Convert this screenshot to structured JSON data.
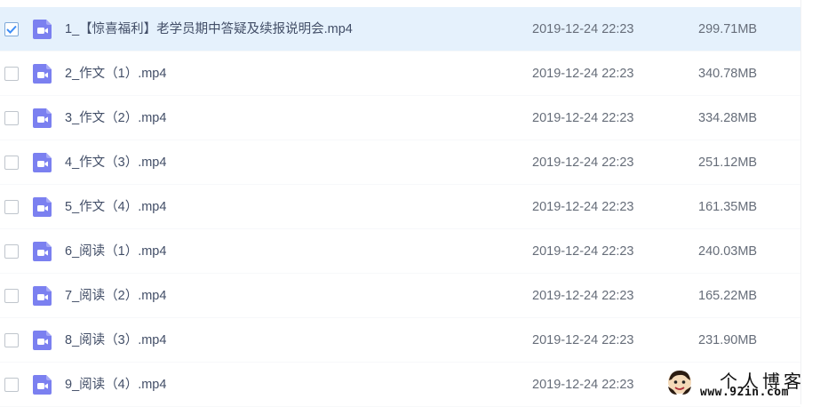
{
  "files": [
    {
      "name": "1_【惊喜福利】老学员期中答疑及续报说明会.mp4",
      "date": "2019-12-24 22:23",
      "size": "299.71MB",
      "checked": true,
      "icon": "video-file-icon"
    },
    {
      "name": "2_作文（1）.mp4",
      "date": "2019-12-24 22:23",
      "size": "340.78MB",
      "checked": false,
      "icon": "video-file-icon"
    },
    {
      "name": "3_作文（2）.mp4",
      "date": "2019-12-24 22:23",
      "size": "334.28MB",
      "checked": false,
      "icon": "video-file-icon"
    },
    {
      "name": "4_作文（3）.mp4",
      "date": "2019-12-24 22:23",
      "size": "251.12MB",
      "checked": false,
      "icon": "video-file-icon"
    },
    {
      "name": "5_作文（4）.mp4",
      "date": "2019-12-24 22:23",
      "size": "161.35MB",
      "checked": false,
      "icon": "video-file-icon"
    },
    {
      "name": "6_阅读（1）.mp4",
      "date": "2019-12-24 22:23",
      "size": "240.03MB",
      "checked": false,
      "icon": "video-file-icon"
    },
    {
      "name": "7_阅读（2）.mp4",
      "date": "2019-12-24 22:23",
      "size": "165.22MB",
      "checked": false,
      "icon": "video-file-icon"
    },
    {
      "name": "8_阅读（3）.mp4",
      "date": "2019-12-24 22:23",
      "size": "231.90MB",
      "checked": false,
      "icon": "video-file-icon"
    },
    {
      "name": "9_阅读（4）.mp4",
      "date": "2019-12-24 22:23",
      "size": "",
      "checked": false,
      "icon": "video-file-icon"
    }
  ],
  "watermark": {
    "title": "个人博客",
    "url": "www.92in.com"
  },
  "colors": {
    "selected_row": "#e5f1fc",
    "icon": "#7b80f0",
    "check": "#3e8ef7"
  }
}
